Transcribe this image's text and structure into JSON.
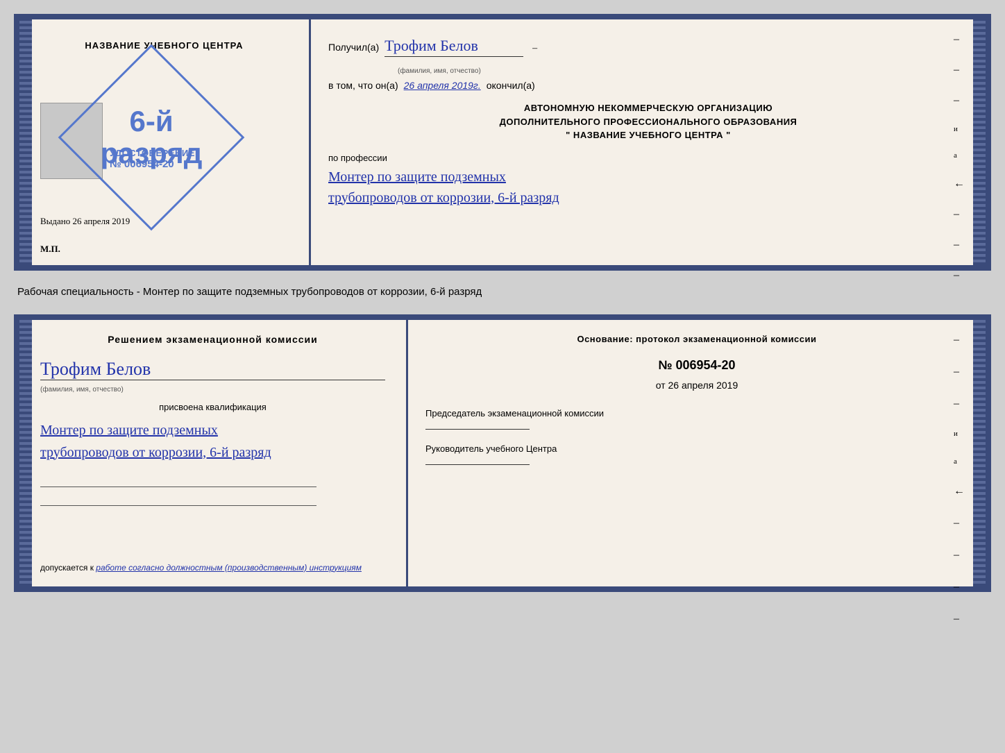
{
  "top_left": {
    "title": "НАЗВАНИЕ УЧЕБНОГО ЦЕНТРА",
    "stamp_text_line1": "6-й",
    "stamp_text_line2": "разряд",
    "cert_label": "УДОСТОВЕРЕНИЕ",
    "cert_number": "№ 006954-20",
    "vydano_label": "Выдано",
    "vydano_date": "26 апреля 2019",
    "mp_label": "М.П."
  },
  "top_right": {
    "poluchil_label": "Получил(a)",
    "recipient_name": "Трофим Белов",
    "name_hint": "(фамилия, имя, отчество)",
    "dash": "–",
    "vtom_label": "в том, что он(а)",
    "date_handwritten": "26 апреля 2019г.",
    "okonchil_label": "окончил(a)",
    "org_line1": "АВТОНОМНУЮ НЕКОММЕРЧЕСКУЮ ОРГАНИЗАЦИЮ",
    "org_line2": "ДОПОЛНИТЕЛЬНОГО ПРОФЕССИОНАЛЬНОГО ОБРАЗОВАНИЯ",
    "org_line3": "\" НАЗВАНИЕ УЧЕБНОГО ЦЕНТРА \"",
    "po_professii_label": "по профессии",
    "profession_line1": "Монтер по защите подземных",
    "profession_line2": "трубопроводов от коррозии, 6-й разряд",
    "side_dashes": [
      "-",
      "-",
      "-",
      "и",
      "а",
      "←",
      "-",
      "-",
      "-"
    ]
  },
  "middle_text": "Рабочая специальность - Монтер по защите подземных трубопроводов от коррозии, 6-й разряд",
  "bottom_left": {
    "komissia_title": "Решением экзаменационной комиссии",
    "recipient_name": "Трофим Белов",
    "name_hint": "(фамилия, имя, отчество)",
    "prisvoena_label": "присвоена квалификация",
    "profession_line1": "Монтер по защите подземных",
    "profession_line2": "трубопроводов от коррозии, 6-й разряд",
    "dopuskaetsya_prefix": "допускается к",
    "dopuskaetsya_text": "работе согласно должностным (производственным) инструкциям"
  },
  "bottom_right": {
    "osnovaniye_title": "Основание: протокол экзаменационной комиссии",
    "protocol_number": "№ 006954-20",
    "date_ot_prefix": "от",
    "date_ot": "26 апреля 2019",
    "chairman_title": "Председатель экзаменационной комиссии",
    "rukovoditel_title": "Руководитель учебного Центра",
    "side_items": [
      "-",
      "-",
      "-",
      "и",
      "а",
      "←",
      "-",
      "-",
      "-",
      "-"
    ]
  }
}
